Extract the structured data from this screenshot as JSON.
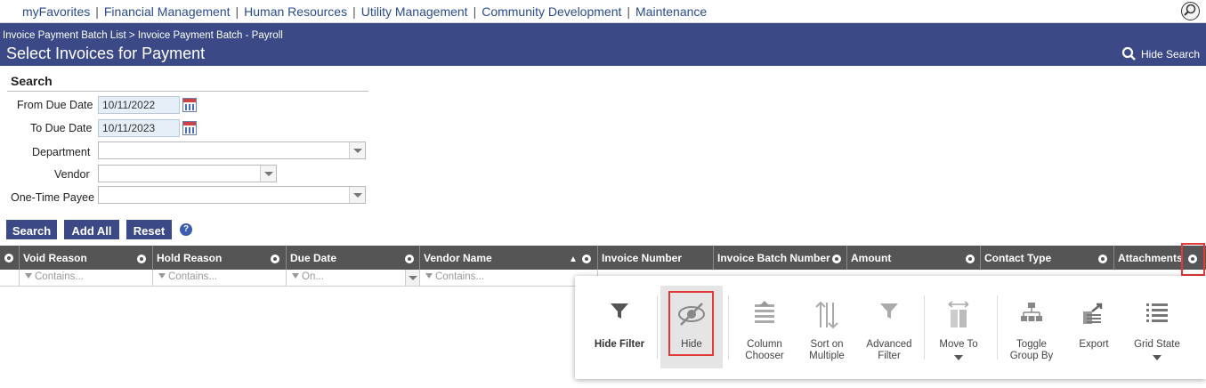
{
  "topnav": {
    "links": [
      "myFavorites",
      "Financial Management",
      "Human Resources",
      "Utility Management",
      "Community Development",
      "Maintenance"
    ]
  },
  "header": {
    "breadcrumb": "Invoice Payment Batch List > Invoice Payment Batch - Payroll",
    "title": "Select Invoices for Payment",
    "hide_search": "Hide Search"
  },
  "search": {
    "heading": "Search",
    "from_label": "From Due Date",
    "from_value": "10/11/2022",
    "to_label": "To Due Date",
    "to_value": "10/11/2023",
    "department_label": "Department",
    "vendor_label": "Vendor",
    "payee_label": "One-Time Payee",
    "buttons": {
      "search": "Search",
      "add_all": "Add All",
      "reset": "Reset"
    },
    "help": "?"
  },
  "grid": {
    "columns": [
      "Void Reason",
      "Hold Reason",
      "Due Date",
      "Vendor Name",
      "Invoice Number",
      "Invoice Batch Number",
      "Amount",
      "Contact Type",
      "Attachments"
    ],
    "filters": {
      "contains": "Contains...",
      "on": "On..."
    }
  },
  "menu": {
    "hide_filter": "Hide Filter",
    "hide": "Hide",
    "column_chooser": [
      "Column",
      "Chooser"
    ],
    "sort_multiple": [
      "Sort on",
      "Multiple"
    ],
    "advanced_filter": [
      "Advanced",
      "Filter"
    ],
    "move_to": "Move To",
    "toggle_group": [
      "Toggle",
      "Group By"
    ],
    "export": "Export",
    "grid_state": "Grid State"
  },
  "colors": {
    "band": "#3b4a86",
    "grid_header": "#555555",
    "highlight": "#e13a3a"
  }
}
